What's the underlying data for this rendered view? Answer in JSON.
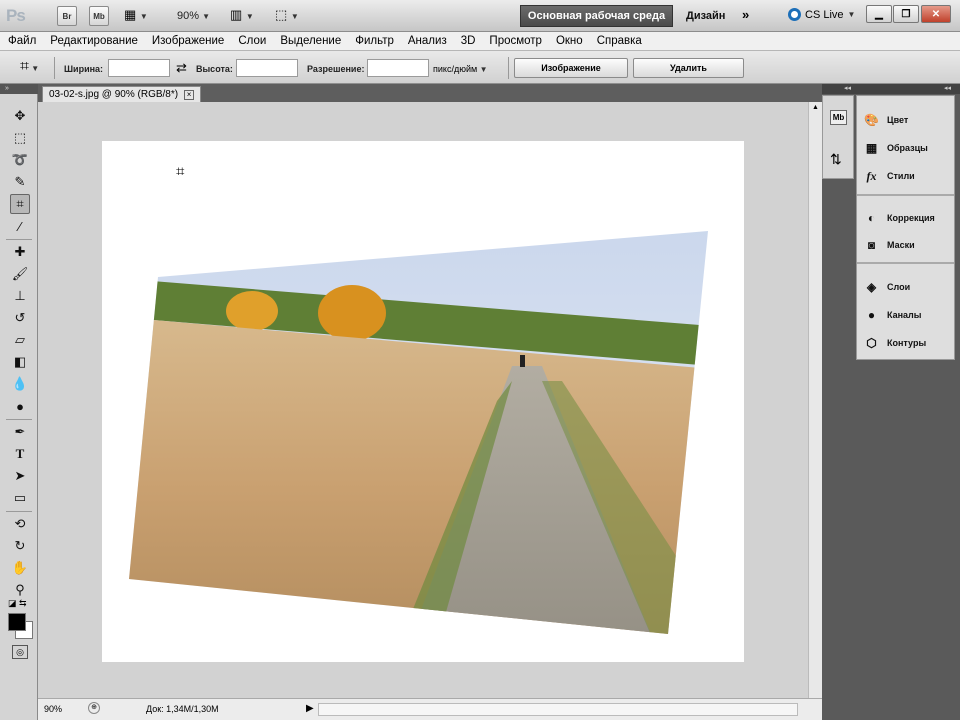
{
  "app": {
    "logo": "Ps",
    "bridge": "Br",
    "mini_bridge": "Mb",
    "zoom": "90%"
  },
  "workspace": {
    "current": "Основная рабочая среда",
    "design": "Дизайн",
    "more": "»",
    "cs_live": "CS Live"
  },
  "menu": [
    "Файл",
    "Редактирование",
    "Изображение",
    "Слои",
    "Выделение",
    "Фильтр",
    "Анализ",
    "3D",
    "Просмотр",
    "Окно",
    "Справка"
  ],
  "options": {
    "width_label": "Ширина:",
    "width_value": "",
    "height_label": "Высота:",
    "height_value": "",
    "resolution_label": "Разрешение:",
    "resolution_value": "",
    "resolution_unit": "пикс/дюйм",
    "image_button": "Изображение",
    "delete_button": "Удалить"
  },
  "document": {
    "tab_title": "03-02-s.jpg @ 90% (RGB/8*)",
    "close": "×"
  },
  "status": {
    "zoom": "90%",
    "doc_info": "Док: 1,34M/1,30M"
  },
  "panels": {
    "group1": [
      "Цвет",
      "Образцы",
      "Стили"
    ],
    "group2": [
      "Коррекция",
      "Маски"
    ],
    "group3": [
      "Слои",
      "Каналы",
      "Контуры"
    ]
  },
  "colors": {
    "foreground": "#000000",
    "background": "#ffffff",
    "workspace_active": "#555555"
  }
}
